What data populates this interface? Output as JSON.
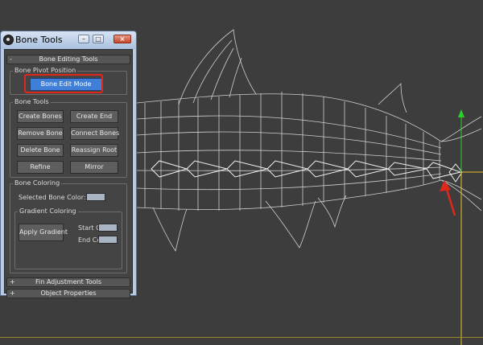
{
  "window": {
    "title": "Bone Tools"
  },
  "rollouts": {
    "bone_editing": {
      "sign": "-",
      "label": "Bone Editing Tools"
    },
    "fin_adjustment": {
      "sign": "+",
      "label": "Fin Adjustment Tools"
    },
    "object_properties": {
      "sign": "+",
      "label": "Object Properties"
    }
  },
  "bone_pivot": {
    "title": "Bone Pivot Position",
    "edit_mode_label": "Bone Edit Mode"
  },
  "bone_tools": {
    "title": "Bone Tools",
    "buttons": [
      "Create Bones",
      "Create End",
      "Remove Bone",
      "Connect Bones",
      "Delete Bone",
      "Reassign Root",
      "Refine",
      "Mirror"
    ]
  },
  "bone_coloring": {
    "title": "Bone Coloring",
    "selected_label": "Selected Bone Color:",
    "gradient_title": "Gradient Coloring",
    "apply_label": "Apply Gradient",
    "start_label": "Start Color:",
    "end_label": "End Color:"
  },
  "colors": {
    "highlight": "#e0271b",
    "active_button": "#3f7fd8",
    "viewport_bg": "#3d3d3d",
    "wireframe": "#e6e6e6",
    "axis_x": "#e6c21f",
    "axis_y": "#2bd02b"
  },
  "icons": [
    "app-icon",
    "minimize-icon",
    "maximize-icon",
    "close-icon",
    "red-arrow-icon",
    "transform-gizmo-icon"
  ]
}
